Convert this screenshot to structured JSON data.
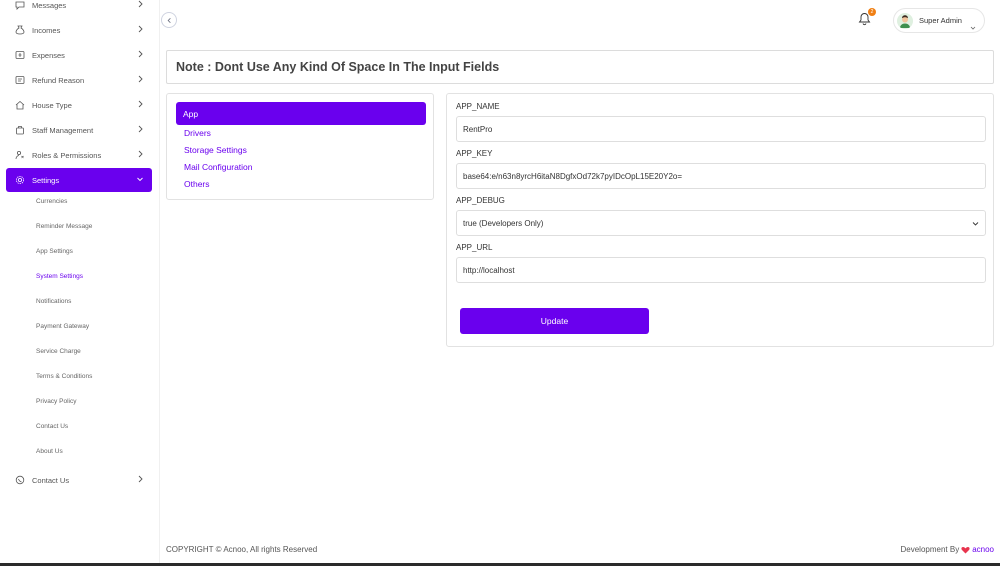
{
  "sidebar": {
    "items": [
      {
        "label": "Messages",
        "icon": "chat-icon"
      },
      {
        "label": "Incomes",
        "icon": "money-bag-icon"
      },
      {
        "label": "Expenses",
        "icon": "expense-icon"
      },
      {
        "label": "Refund Reason",
        "icon": "refund-icon"
      },
      {
        "label": "House Type",
        "icon": "house-icon"
      },
      {
        "label": "Staff Management",
        "icon": "staff-icon"
      },
      {
        "label": "Roles & Permissions",
        "icon": "roles-icon"
      },
      {
        "label": "Settings",
        "icon": "gear-icon",
        "active": true
      },
      {
        "label": "Contact Us",
        "icon": "contact-icon"
      }
    ],
    "settings_sub": [
      {
        "label": "Currencies"
      },
      {
        "label": "Reminder Message"
      },
      {
        "label": "App Settings"
      },
      {
        "label": "System Settings",
        "active": true
      },
      {
        "label": "Notifications"
      },
      {
        "label": "Payment Gateway"
      },
      {
        "label": "Service Charge"
      },
      {
        "label": "Terms & Conditions"
      },
      {
        "label": "Privacy Policy"
      },
      {
        "label": "Contact Us"
      },
      {
        "label": "About Us"
      }
    ]
  },
  "header": {
    "notification_count": "2",
    "user_name": "Super Admin"
  },
  "note": "Note : Dont Use Any Kind Of Space In The Input Fields",
  "tabs": [
    {
      "label": "App",
      "active": true
    },
    {
      "label": "Drivers"
    },
    {
      "label": "Storage Settings"
    },
    {
      "label": "Mail Configuration"
    },
    {
      "label": "Others"
    }
  ],
  "form": {
    "app_name_label": "APP_NAME",
    "app_name_value": "RentPro",
    "app_key_label": "APP_KEY",
    "app_key_value": "base64:e/n63n8yrcH6itaN8DgfxOd72k7pyIDcOpL15E20Y2o=",
    "app_debug_label": "APP_DEBUG",
    "app_debug_value": "true (Developers Only)",
    "app_url_label": "APP_URL",
    "app_url_value": "http://localhost",
    "update_label": "Update"
  },
  "footer": {
    "copyright": "COPYRIGHT © Acnoo, All rights Reserved",
    "dev_by": "Development By",
    "brand": "acnoo"
  },
  "colors": {
    "accent": "#6a00ee",
    "badge": "#f07f13",
    "heart": "#e8344e"
  }
}
